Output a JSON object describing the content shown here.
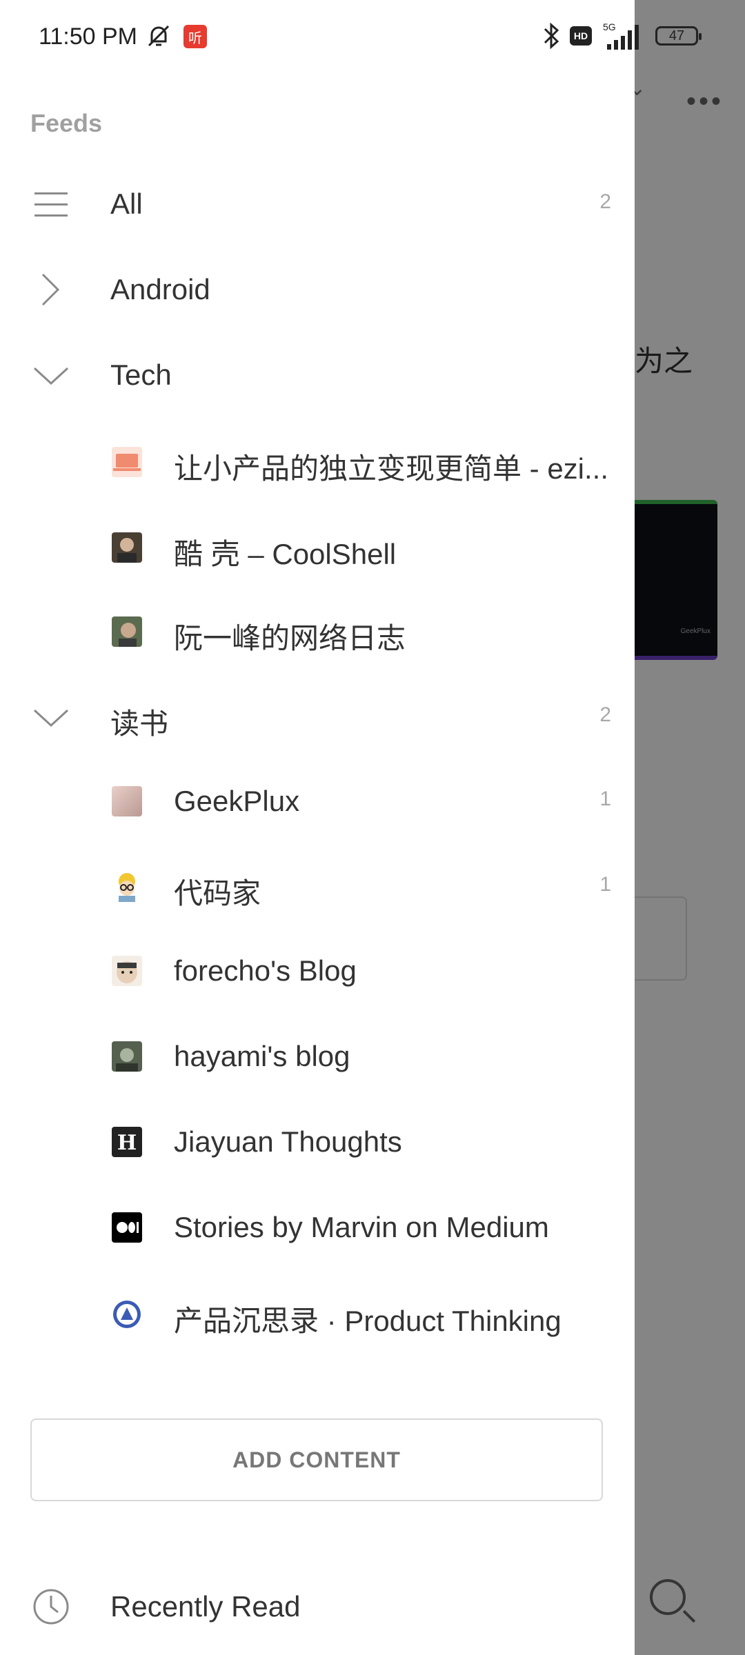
{
  "status_bar": {
    "time": "11:50 PM",
    "notif_badge": "听",
    "hd": "HD",
    "network": "5G",
    "battery": "47"
  },
  "background": {
    "snippet_text": "为之",
    "thumb_caption": "GeekPlux"
  },
  "drawer": {
    "section_title": "Feeds",
    "all": {
      "label": "All",
      "count": "2",
      "icon": "hamburger-icon"
    },
    "groups": [
      {
        "label": "Android",
        "expanded": false,
        "count": ""
      },
      {
        "label": "Tech",
        "expanded": true,
        "count": "",
        "items": [
          {
            "label": "让小产品的独立变现更简单 - ezi...",
            "count": "",
            "favicon_color": "#f08b6f"
          },
          {
            "label": "酷 壳 – CoolShell",
            "count": "",
            "favicon_color": "#6a5a4a"
          },
          {
            "label": "阮一峰的网络日志",
            "count": "",
            "favicon_color": "#5b6b4f"
          }
        ]
      },
      {
        "label": "读书",
        "expanded": true,
        "count": "2",
        "items": [
          {
            "label": "GeekPlux",
            "count": "1",
            "favicon_color": "#d9b7b0"
          },
          {
            "label": "代码家",
            "count": "1",
            "favicon_color": "#f2c832"
          },
          {
            "label": "forecho's Blog",
            "count": "",
            "favicon_color": "#e8d6c4"
          },
          {
            "label": "hayami's blog",
            "count": "",
            "favicon_color": "#6e7a6a"
          },
          {
            "label": "Jiayuan Thoughts",
            "count": "",
            "favicon_color": "#222222"
          },
          {
            "label": "Stories by Marvin on Medium",
            "count": "",
            "favicon_color": "#000000"
          },
          {
            "label": "产品沉思录 · Product Thinking",
            "count": "",
            "favicon_color": "#3b5bb5"
          }
        ]
      }
    ],
    "add_content_label": "ADD CONTENT",
    "recently_read_label": "Recently Read"
  },
  "colors": {
    "text_primary": "#333333",
    "text_muted": "#a0a0a0",
    "scrim": "rgba(0,0,0,0.48)"
  }
}
